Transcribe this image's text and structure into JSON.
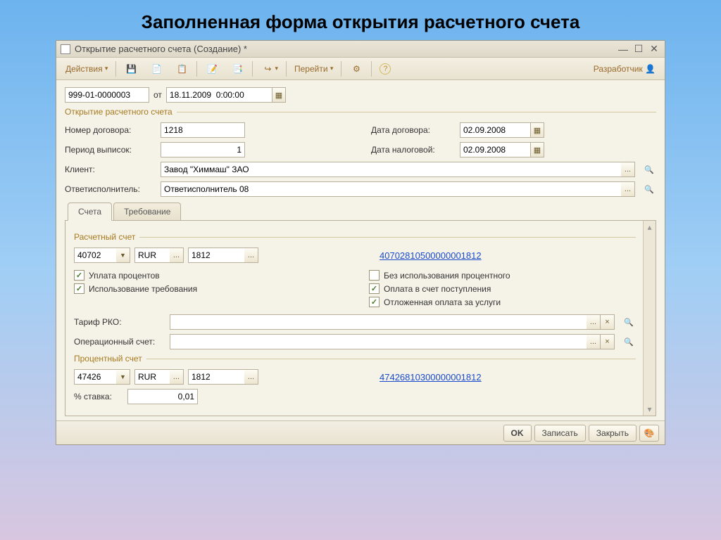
{
  "slideTitle": "Заполненная форма открытия расчетного счета",
  "window": {
    "title": "Открытие расчетного счета (Создание) *"
  },
  "toolbar": {
    "actions": "Действия",
    "goto": "Перейти",
    "developer": "Разработчик"
  },
  "header": {
    "docNumber": "999-01-0000003",
    "fromLabel": "от",
    "docDate": "18.11.2009  0:00:00"
  },
  "section1": {
    "title": "Открытие расчетного счета",
    "contractNumLabel": "Номер договора:",
    "contractNum": "1218",
    "contractDateLabel": "Дата договора:",
    "contractDate": "02.09.2008",
    "statementPeriodLabel": "Период выписок:",
    "statementPeriod": "1",
    "taxDateLabel": "Дата налоговой:",
    "taxDate": "02.09.2008",
    "clientLabel": "Клиент:",
    "clientValue": "Завод \"Химмаш\" ЗАО",
    "executorLabel": "Ответисполнитель:",
    "executorValue": "Ответисполнитель 08"
  },
  "tabs": {
    "accounts": "Счета",
    "requirement": "Требование"
  },
  "accountSection": {
    "title": "Расчетный счет",
    "code1": "40702",
    "currency": "RUR",
    "code2": "1812",
    "fullAccount": "40702810500000001812",
    "chk_interest": "Уплата процентов",
    "chk_noPercent": "Без использования процентного",
    "chk_useReq": "Использование требования",
    "chk_payIncoming": "Оплата в счет поступления",
    "chk_deferred": "Отложенная оплата за услуги",
    "tariffLabel": "Тариф РКО:",
    "opAccountLabel": "Операционный счет:"
  },
  "percentSection": {
    "title": "Процентный счет",
    "code1": "47426",
    "currency": "RUR",
    "code2": "1812",
    "fullAccount": "47426810300000001812",
    "rateLabel": "% ставка:",
    "rateValue": "0,01"
  },
  "footer": {
    "ok": "OK",
    "save": "Записать",
    "close": "Закрыть"
  },
  "glyphs": {
    "ellipsis": "...",
    "clear": "×",
    "mag": "🔍",
    "dd": "▼",
    "cal": "▦",
    "help": "?"
  }
}
